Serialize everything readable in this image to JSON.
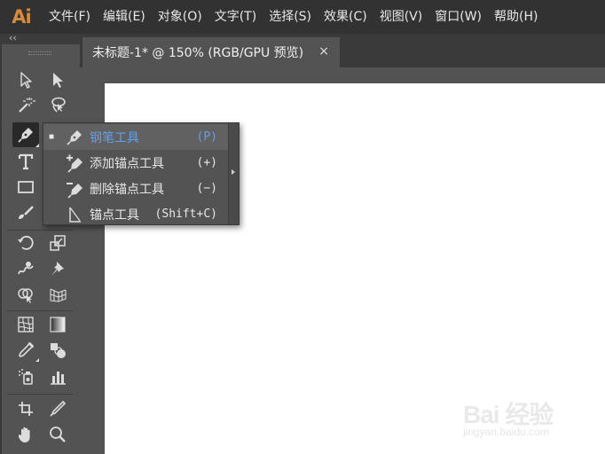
{
  "app": {
    "logo_text": "Ai",
    "accent_color": "#d98b3a"
  },
  "menu": [
    {
      "label": "文件(F)"
    },
    {
      "label": "编辑(E)"
    },
    {
      "label": "对象(O)"
    },
    {
      "label": "文字(T)"
    },
    {
      "label": "选择(S)"
    },
    {
      "label": "效果(C)"
    },
    {
      "label": "视图(V)"
    },
    {
      "label": "窗口(W)"
    },
    {
      "label": "帮助(H)"
    }
  ],
  "toolpanel": {
    "collapse_glyph": "‹‹"
  },
  "document_tab": {
    "title": "未标题-1* @ 150% (RGB/GPU 预览)",
    "close_glyph": "×"
  },
  "flyout": {
    "items": [
      {
        "mark": "■",
        "icon": "pen-icon",
        "label": "钢笔工具",
        "shortcut": "(P)",
        "selected": true
      },
      {
        "mark": "",
        "icon": "add-anchor-point-icon",
        "label": "添加锚点工具",
        "shortcut": "(+)",
        "selected": false
      },
      {
        "mark": "",
        "icon": "delete-anchor-point-icon",
        "label": "删除锚点工具",
        "shortcut": "(−)",
        "selected": false
      },
      {
        "mark": "",
        "icon": "anchor-point-icon",
        "label": "锚点工具",
        "shortcut": "(Shift+C)",
        "selected": false
      }
    ],
    "selected_color": "#5aa2f5"
  },
  "tools": [
    "selection-icon",
    "direct-selection-icon",
    "magic-wand-icon",
    "lasso-icon",
    "pen-icon",
    "curvature-icon",
    "type-icon",
    "line-segment-icon",
    "rectangle-icon",
    "paintbrush-icon",
    "shaper-icon",
    "eraser-icon",
    "rotate-icon",
    "scale-icon",
    "warp-icon",
    "free-transform-icon",
    "shape-builder-icon",
    "perspective-grid-icon",
    "mesh-icon",
    "gradient-icon",
    "eyedropper-icon",
    "blend-icon",
    "symbol-sprayer-icon",
    "column-graph-icon",
    "artboard-icon",
    "slice-icon",
    "hand-icon",
    "zoom-icon"
  ],
  "watermark": {
    "brand": "Bai 经验",
    "sub": "jingyan.baidu.com"
  }
}
